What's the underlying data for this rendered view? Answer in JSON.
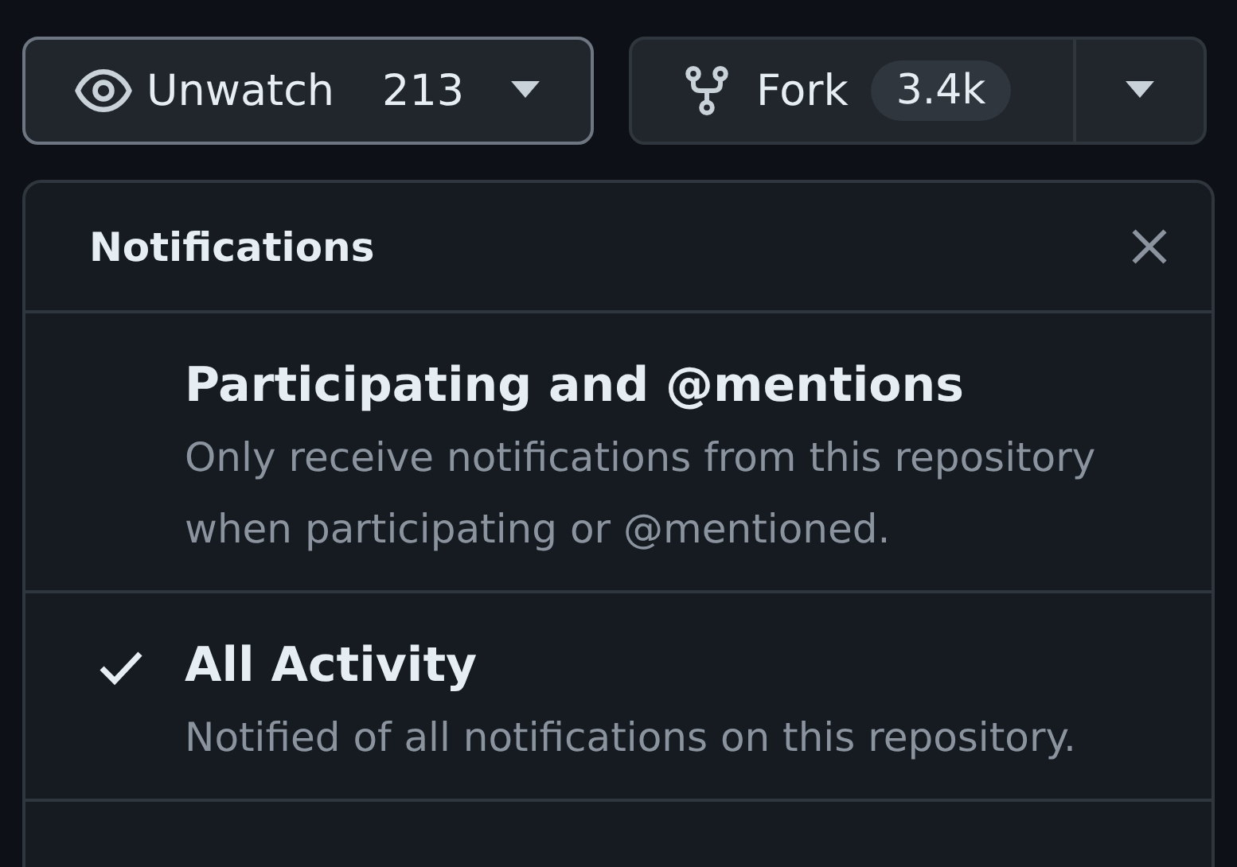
{
  "watch_button": {
    "label": "Unwatch",
    "count": "213"
  },
  "fork_button": {
    "label": "Fork",
    "count": "3.4k"
  },
  "menu": {
    "title": "Notifications",
    "items": [
      {
        "title": "Participating and @mentions",
        "description": "Only receive notifications from this repository when participating or @mentioned.",
        "selected": false
      },
      {
        "title": "All Activity",
        "description": "Notified of all notifications on this repository.",
        "selected": true
      }
    ]
  }
}
